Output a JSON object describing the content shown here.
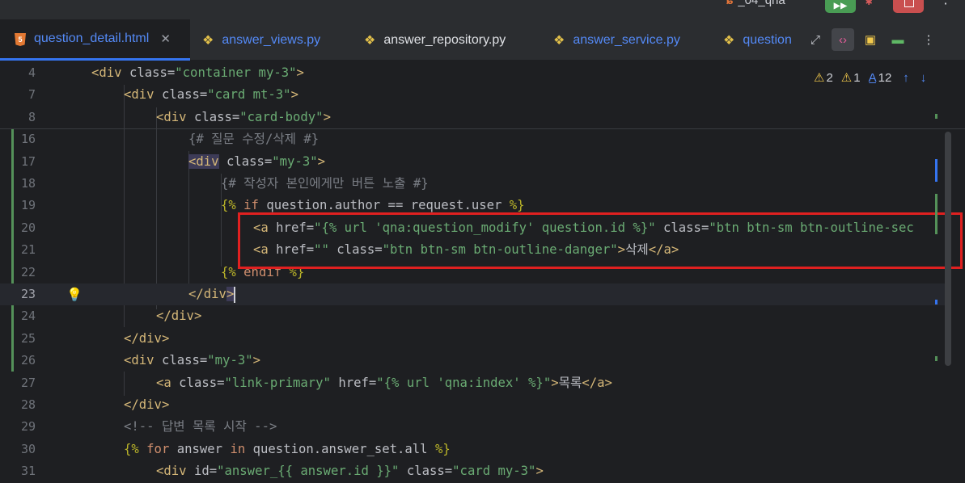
{
  "titlebar": {
    "project_name": "_04_qna",
    "project_icon": "gitlab-icon"
  },
  "tabs": [
    {
      "label": "question_detail.html",
      "icon": "html5-icon",
      "active": true
    },
    {
      "label": "answer_views.py",
      "icon": "python-icon"
    },
    {
      "label": "answer_repository.py",
      "icon": "python-icon"
    },
    {
      "label": "answer_service.py",
      "icon": "python-icon"
    },
    {
      "label": "question",
      "icon": "python-icon"
    }
  ],
  "inspections": {
    "warnings": "2",
    "weak_warnings": "1",
    "typos": "12"
  },
  "lines": [
    {
      "num": "4"
    },
    {
      "num": "7"
    },
    {
      "num": "8"
    },
    {
      "num": "16"
    },
    {
      "num": "17"
    },
    {
      "num": "18"
    },
    {
      "num": "19"
    },
    {
      "num": "20"
    },
    {
      "num": "21"
    },
    {
      "num": "22"
    },
    {
      "num": "23"
    },
    {
      "num": "24"
    },
    {
      "num": "25"
    },
    {
      "num": "26"
    },
    {
      "num": "27"
    },
    {
      "num": "28"
    },
    {
      "num": "29"
    },
    {
      "num": "30"
    },
    {
      "num": "31"
    }
  ],
  "code": {
    "l4": {
      "open": "<div",
      "attr": " class=",
      "val": "\"container my-3\"",
      "close": ">"
    },
    "l7": {
      "open": "<div",
      "attr": " class=",
      "val": "\"card mt-3\"",
      "close": ">"
    },
    "l8": {
      "open": "<div",
      "attr": " class=",
      "val": "\"card-body\"",
      "close": ">"
    },
    "l16": {
      "comment": "{# 질문 수정/삭제 #}"
    },
    "l17": {
      "open": "<div",
      "attr": " class=",
      "val": "\"my-3\"",
      "close": ">"
    },
    "l18": {
      "comment": "{# 작성자 본인에게만 버튼 노출 #}"
    },
    "l19": {
      "tpl_open": "{%",
      "kw": " if ",
      "expr": "question.author == request.user ",
      "tpl_close": "%}"
    },
    "l20": {
      "open": "<a",
      "attr1": " href=",
      "val1": "\"{% url 'qna:question_modify' question.id %}\"",
      "attr2": " class=",
      "val2": "\"btn btn-sm btn-outline-sec"
    },
    "l21": {
      "open": "<a",
      "attr1": " href=",
      "val1": "\"\"",
      "attr2": " class=",
      "val2": "\"btn btn-sm btn-outline-danger\"",
      "close": ">",
      "text": "삭제",
      "end": "</a>"
    },
    "l22": {
      "tpl_open": "{%",
      "kw": " endif ",
      "tpl_close": "%}"
    },
    "l23": {
      "end": "</div",
      "close": ">"
    },
    "l24": {
      "end": "</div>"
    },
    "l25": {
      "end": "</div>"
    },
    "l26": {
      "open": "<div",
      "attr": " class=",
      "val": "\"my-3\"",
      "close": ">"
    },
    "l27": {
      "open": "<a",
      "attr1": " class=",
      "val1": "\"link-primary\"",
      "attr2": " href=",
      "val2": "\"{% url 'qna:index' %}\"",
      "close": ">",
      "text": "목록",
      "end": "</a>"
    },
    "l28": {
      "end": "</div>"
    },
    "l29": {
      "comment": "<!-- 답변 목록 시작 -->"
    },
    "l30": {
      "tpl_open": "{%",
      "kw1": " for ",
      "var": "answer",
      "kw2": " in ",
      "expr": "question.answer_set.all ",
      "tpl_close": "%}"
    },
    "l31": {
      "open": "<div",
      "attr1": " id=",
      "val1": "\"answer_{{ answer.id }}\"",
      "attr2": " class=",
      "val2": "\"card my-3\"",
      "close": ">"
    }
  }
}
